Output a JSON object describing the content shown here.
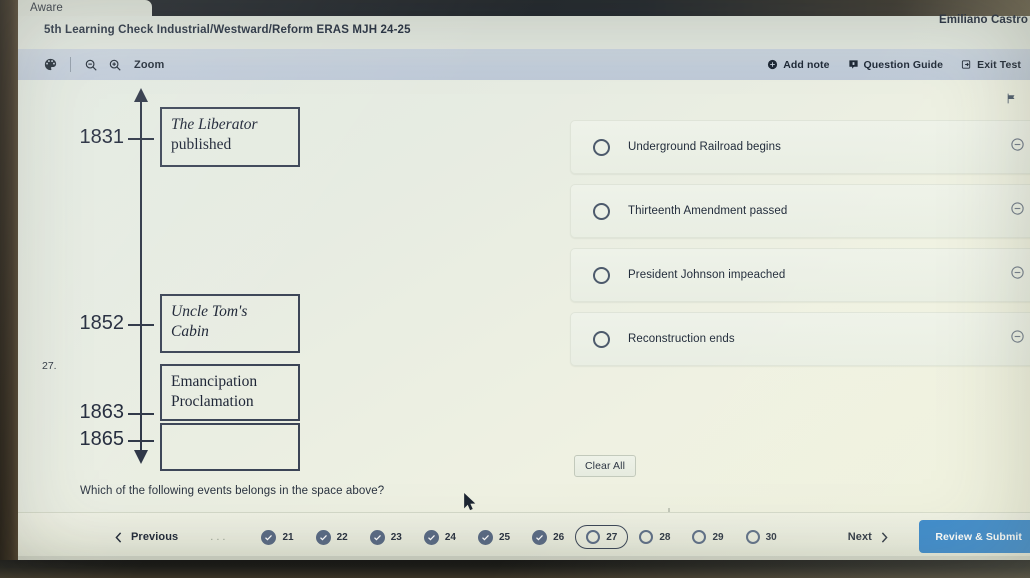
{
  "browser": {
    "tab_label": "Aware"
  },
  "header": {
    "test_title": "5th Learning Check Industrial/Westward/Reform ERAS MJH 24-25",
    "user_name": "Emiliano Castro"
  },
  "toolbar": {
    "palette_icon": "palette-icon",
    "zoom_out_icon": "zoom-out-icon",
    "zoom_in_icon": "zoom-in-icon",
    "zoom_label": "Zoom",
    "add_note_label": "Add note",
    "question_guide_label": "Question Guide",
    "exit_test_label": "Exit Test"
  },
  "question": {
    "number": "27.",
    "flag_icon": "flag-icon",
    "stem_text": "Which of the following events belongs in the space above?",
    "clear_all_label": "Clear All"
  },
  "timeline": {
    "years": [
      "1831",
      "1852",
      "1863",
      "1865"
    ],
    "events": [
      {
        "line1": "The Liberator",
        "line2": "published",
        "italic_line": 1
      },
      {
        "line1": "Uncle Tom's",
        "line2": "Cabin",
        "italic_line": 2
      },
      {
        "line1": "Emancipation",
        "line2": "Proclamation",
        "italic_line": 0
      },
      {
        "line1": "",
        "line2": "",
        "italic_line": 0
      }
    ]
  },
  "answers": [
    {
      "label": "Underground Railroad begins",
      "selected": false,
      "eliminate_icon": "minus-circle-icon"
    },
    {
      "label": "Thirteenth Amendment passed",
      "selected": false,
      "eliminate_icon": "minus-circle-icon"
    },
    {
      "label": "President Johnson impeached",
      "selected": false,
      "eliminate_icon": "minus-circle-icon"
    },
    {
      "label": "Reconstruction ends",
      "selected": false,
      "eliminate_icon": "minus-circle-icon"
    }
  ],
  "bottom_nav": {
    "previous_label": "Previous",
    "ellipsis": "...",
    "next_label": "Next",
    "review_submit_label": "Review & Submit",
    "questions": [
      {
        "number": "21",
        "state": "answered"
      },
      {
        "number": "22",
        "state": "answered"
      },
      {
        "number": "23",
        "state": "answered"
      },
      {
        "number": "24",
        "state": "answered"
      },
      {
        "number": "25",
        "state": "answered"
      },
      {
        "number": "26",
        "state": "answered"
      },
      {
        "number": "27",
        "state": "current"
      },
      {
        "number": "28",
        "state": "unanswered"
      },
      {
        "number": "29",
        "state": "unanswered"
      },
      {
        "number": "30",
        "state": "unanswered"
      }
    ]
  },
  "colors": {
    "accent_blue": "#2a7fc9",
    "nav_dot": "#5a6b85",
    "text_dark": "#222c3b",
    "page_bg": "#e7ece2"
  }
}
